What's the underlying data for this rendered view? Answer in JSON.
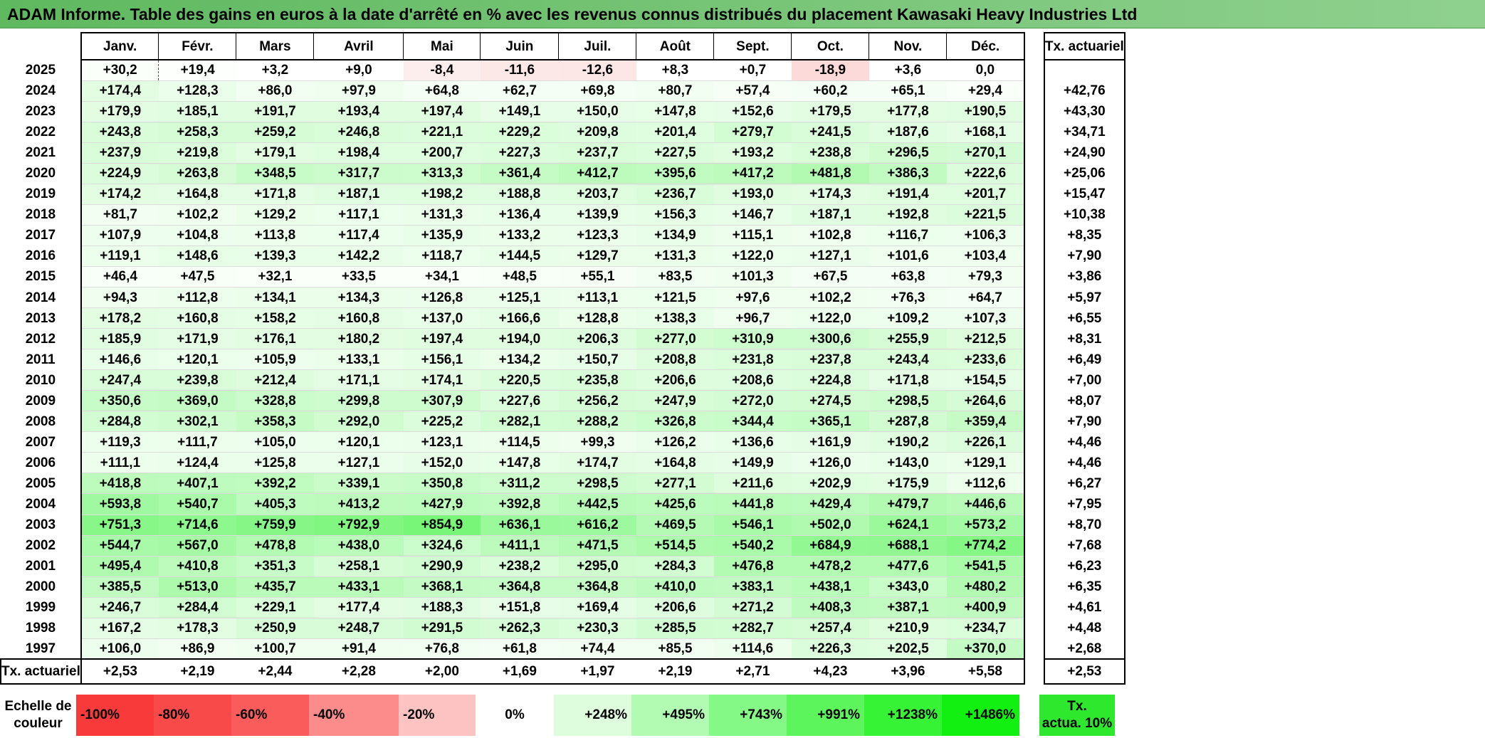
{
  "title": "ADAM Informe. Table des gains en euros à la date d'arrêté en % avec les revenus connus distribués du placement Kawasaki Heavy Industries Ltd",
  "months": [
    "Janv.",
    "Févr.",
    "Mars",
    "Avril",
    "Mai",
    "Juin",
    "Juil.",
    "Août",
    "Sept.",
    "Oct.",
    "Nov.",
    "Déc."
  ],
  "actuarial_header": "Tx. actuariel",
  "rows": [
    {
      "year": "2025",
      "values": [
        "+30,2",
        "+19,4",
        "+3,2",
        "+9,0",
        "-8,4",
        "-11,6",
        "-12,6",
        "+8,3",
        "+0,7",
        "-18,9",
        "+3,6",
        "0,0"
      ],
      "rate": ""
    },
    {
      "year": "2024",
      "values": [
        "+174,4",
        "+128,3",
        "+86,0",
        "+97,9",
        "+64,8",
        "+62,7",
        "+69,8",
        "+80,7",
        "+57,4",
        "+60,2",
        "+65,1",
        "+29,4"
      ],
      "rate": "+42,76"
    },
    {
      "year": "2023",
      "values": [
        "+179,9",
        "+185,1",
        "+191,7",
        "+193,4",
        "+197,4",
        "+149,1",
        "+150,0",
        "+147,8",
        "+152,6",
        "+179,5",
        "+177,8",
        "+190,5"
      ],
      "rate": "+43,30"
    },
    {
      "year": "2022",
      "values": [
        "+243,8",
        "+258,3",
        "+259,2",
        "+246,8",
        "+221,1",
        "+229,2",
        "+209,8",
        "+201,4",
        "+279,7",
        "+241,5",
        "+187,6",
        "+168,1"
      ],
      "rate": "+34,71"
    },
    {
      "year": "2021",
      "values": [
        "+237,9",
        "+219,8",
        "+179,1",
        "+198,4",
        "+200,7",
        "+227,3",
        "+237,7",
        "+227,5",
        "+193,2",
        "+238,8",
        "+296,5",
        "+270,1"
      ],
      "rate": "+24,90"
    },
    {
      "year": "2020",
      "values": [
        "+224,9",
        "+263,8",
        "+348,5",
        "+317,7",
        "+313,3",
        "+361,4",
        "+412,7",
        "+395,6",
        "+417,2",
        "+481,8",
        "+386,3",
        "+222,6"
      ],
      "rate": "+25,06"
    },
    {
      "year": "2019",
      "values": [
        "+174,2",
        "+164,8",
        "+171,8",
        "+187,1",
        "+198,2",
        "+188,8",
        "+203,7",
        "+236,7",
        "+193,0",
        "+174,3",
        "+191,4",
        "+201,7"
      ],
      "rate": "+15,47"
    },
    {
      "year": "2018",
      "values": [
        "+81,7",
        "+102,2",
        "+129,2",
        "+117,1",
        "+131,3",
        "+136,4",
        "+139,9",
        "+156,3",
        "+146,7",
        "+187,1",
        "+192,8",
        "+221,5"
      ],
      "rate": "+10,38"
    },
    {
      "year": "2017",
      "values": [
        "+107,9",
        "+104,8",
        "+113,8",
        "+117,4",
        "+135,9",
        "+133,2",
        "+123,3",
        "+134,9",
        "+115,1",
        "+102,8",
        "+116,7",
        "+106,3"
      ],
      "rate": "+8,35"
    },
    {
      "year": "2016",
      "values": [
        "+119,1",
        "+148,6",
        "+139,3",
        "+142,2",
        "+118,7",
        "+144,5",
        "+129,7",
        "+131,3",
        "+122,0",
        "+127,1",
        "+101,6",
        "+103,4"
      ],
      "rate": "+7,90"
    },
    {
      "year": "2015",
      "values": [
        "+46,4",
        "+47,5",
        "+32,1",
        "+33,5",
        "+34,1",
        "+48,5",
        "+55,1",
        "+83,5",
        "+101,3",
        "+67,5",
        "+63,8",
        "+79,3"
      ],
      "rate": "+3,86"
    },
    {
      "year": "2014",
      "values": [
        "+94,3",
        "+112,8",
        "+134,1",
        "+134,3",
        "+126,8",
        "+125,1",
        "+113,1",
        "+121,5",
        "+97,6",
        "+102,2",
        "+76,3",
        "+64,7"
      ],
      "rate": "+5,97"
    },
    {
      "year": "2013",
      "values": [
        "+178,2",
        "+160,8",
        "+158,2",
        "+160,8",
        "+137,0",
        "+166,6",
        "+128,8",
        "+138,3",
        "+96,7",
        "+122,0",
        "+109,2",
        "+107,3"
      ],
      "rate": "+6,55"
    },
    {
      "year": "2012",
      "values": [
        "+185,9",
        "+171,9",
        "+176,1",
        "+180,2",
        "+197,4",
        "+194,0",
        "+206,3",
        "+277,0",
        "+310,9",
        "+300,6",
        "+255,9",
        "+212,5"
      ],
      "rate": "+8,31"
    },
    {
      "year": "2011",
      "values": [
        "+146,6",
        "+120,1",
        "+105,9",
        "+133,1",
        "+156,1",
        "+134,2",
        "+150,7",
        "+208,8",
        "+231,8",
        "+237,8",
        "+243,4",
        "+233,6"
      ],
      "rate": "+6,49"
    },
    {
      "year": "2010",
      "values": [
        "+247,4",
        "+239,8",
        "+212,4",
        "+171,1",
        "+174,1",
        "+220,5",
        "+235,8",
        "+206,6",
        "+208,6",
        "+224,8",
        "+171,8",
        "+154,5"
      ],
      "rate": "+7,00"
    },
    {
      "year": "2009",
      "values": [
        "+350,6",
        "+369,0",
        "+328,8",
        "+299,8",
        "+307,9",
        "+227,6",
        "+256,2",
        "+247,9",
        "+272,0",
        "+274,5",
        "+298,5",
        "+264,6"
      ],
      "rate": "+8,07"
    },
    {
      "year": "2008",
      "values": [
        "+284,8",
        "+302,1",
        "+358,3",
        "+292,0",
        "+225,2",
        "+282,1",
        "+288,2",
        "+326,8",
        "+344,4",
        "+365,1",
        "+287,8",
        "+359,4"
      ],
      "rate": "+7,90"
    },
    {
      "year": "2007",
      "values": [
        "+119,3",
        "+111,7",
        "+105,0",
        "+120,1",
        "+123,1",
        "+114,5",
        "+99,3",
        "+126,2",
        "+136,6",
        "+161,9",
        "+190,2",
        "+226,1"
      ],
      "rate": "+4,46"
    },
    {
      "year": "2006",
      "values": [
        "+111,1",
        "+124,4",
        "+125,8",
        "+127,1",
        "+152,0",
        "+147,8",
        "+174,7",
        "+164,8",
        "+149,9",
        "+126,0",
        "+143,0",
        "+129,1"
      ],
      "rate": "+4,46"
    },
    {
      "year": "2005",
      "values": [
        "+418,8",
        "+407,1",
        "+392,2",
        "+339,1",
        "+350,8",
        "+311,2",
        "+298,5",
        "+277,1",
        "+211,6",
        "+202,9",
        "+175,9",
        "+112,6"
      ],
      "rate": "+6,27"
    },
    {
      "year": "2004",
      "values": [
        "+593,8",
        "+540,7",
        "+405,3",
        "+413,2",
        "+427,9",
        "+392,8",
        "+442,5",
        "+425,6",
        "+441,8",
        "+429,4",
        "+479,7",
        "+446,6"
      ],
      "rate": "+7,95"
    },
    {
      "year": "2003",
      "values": [
        "+751,3",
        "+714,6",
        "+759,9",
        "+792,9",
        "+854,9",
        "+636,1",
        "+616,2",
        "+469,5",
        "+546,1",
        "+502,0",
        "+624,1",
        "+573,2"
      ],
      "rate": "+8,70"
    },
    {
      "year": "2002",
      "values": [
        "+544,7",
        "+567,0",
        "+478,8",
        "+438,0",
        "+324,6",
        "+411,1",
        "+471,5",
        "+514,5",
        "+540,2",
        "+684,9",
        "+688,1",
        "+774,2"
      ],
      "rate": "+7,68"
    },
    {
      "year": "2001",
      "values": [
        "+495,4",
        "+410,8",
        "+351,3",
        "+258,1",
        "+290,9",
        "+238,2",
        "+295,0",
        "+284,3",
        "+476,8",
        "+478,2",
        "+477,6",
        "+541,5"
      ],
      "rate": "+6,23"
    },
    {
      "year": "2000",
      "values": [
        "+385,5",
        "+513,0",
        "+435,7",
        "+433,1",
        "+368,1",
        "+364,8",
        "+364,8",
        "+410,0",
        "+383,1",
        "+438,1",
        "+343,0",
        "+480,2"
      ],
      "rate": "+6,35"
    },
    {
      "year": "1999",
      "values": [
        "+246,7",
        "+284,4",
        "+229,1",
        "+177,4",
        "+188,3",
        "+151,8",
        "+169,4",
        "+206,6",
        "+271,2",
        "+408,3",
        "+387,1",
        "+400,9"
      ],
      "rate": "+4,61"
    },
    {
      "year": "1998",
      "values": [
        "+167,2",
        "+178,3",
        "+250,9",
        "+248,7",
        "+291,5",
        "+262,3",
        "+230,3",
        "+285,5",
        "+282,7",
        "+257,4",
        "+210,9",
        "+234,7"
      ],
      "rate": "+4,48"
    },
    {
      "year": "1997",
      "values": [
        "+106,0",
        "+86,9",
        "+100,7",
        "+91,4",
        "+76,8",
        "+61,8",
        "+74,4",
        "+85,5",
        "+114,6",
        "+226,3",
        "+202,5",
        "+370,0"
      ],
      "rate": "+2,68"
    }
  ],
  "footer": {
    "label": "Tx. actuariel",
    "values": [
      "+2,53",
      "+2,19",
      "+2,44",
      "+2,28",
      "+2,00",
      "+1,69",
      "+1,97",
      "+2,19",
      "+2,71",
      "+4,23",
      "+3,96",
      "+5,58"
    ],
    "rate": "+2,53"
  },
  "legend": {
    "label_line1": "Echelle de",
    "label_line2": "couleur",
    "items": [
      {
        "label": "-100%",
        "color": "#f83a3a",
        "align": "neg"
      },
      {
        "label": "-80%",
        "color": "#f94a4a",
        "align": "neg"
      },
      {
        "label": "-60%",
        "color": "#fa5c5c",
        "align": "neg"
      },
      {
        "label": "-40%",
        "color": "#fc8c8c",
        "align": "neg"
      },
      {
        "label": "-20%",
        "color": "#fdc2c2",
        "align": "neg"
      },
      {
        "label": "0%",
        "color": "#ffffff",
        "align": "zero"
      },
      {
        "label": "+248%",
        "color": "#ddfddd",
        "align": "pos"
      },
      {
        "label": "+495%",
        "color": "#b2fbb2",
        "align": "pos"
      },
      {
        "label": "+743%",
        "color": "#85f985",
        "align": "pos"
      },
      {
        "label": "+991%",
        "color": "#5cf65c",
        "align": "pos"
      },
      {
        "label": "+1238%",
        "color": "#36f336",
        "align": "pos"
      },
      {
        "label": "+1486%",
        "color": "#12f012",
        "align": "pos"
      }
    ],
    "actuarial_line1": "Tx.",
    "actuarial_line2": "actua. 10%",
    "actuarial_color": "#2ee82e"
  }
}
